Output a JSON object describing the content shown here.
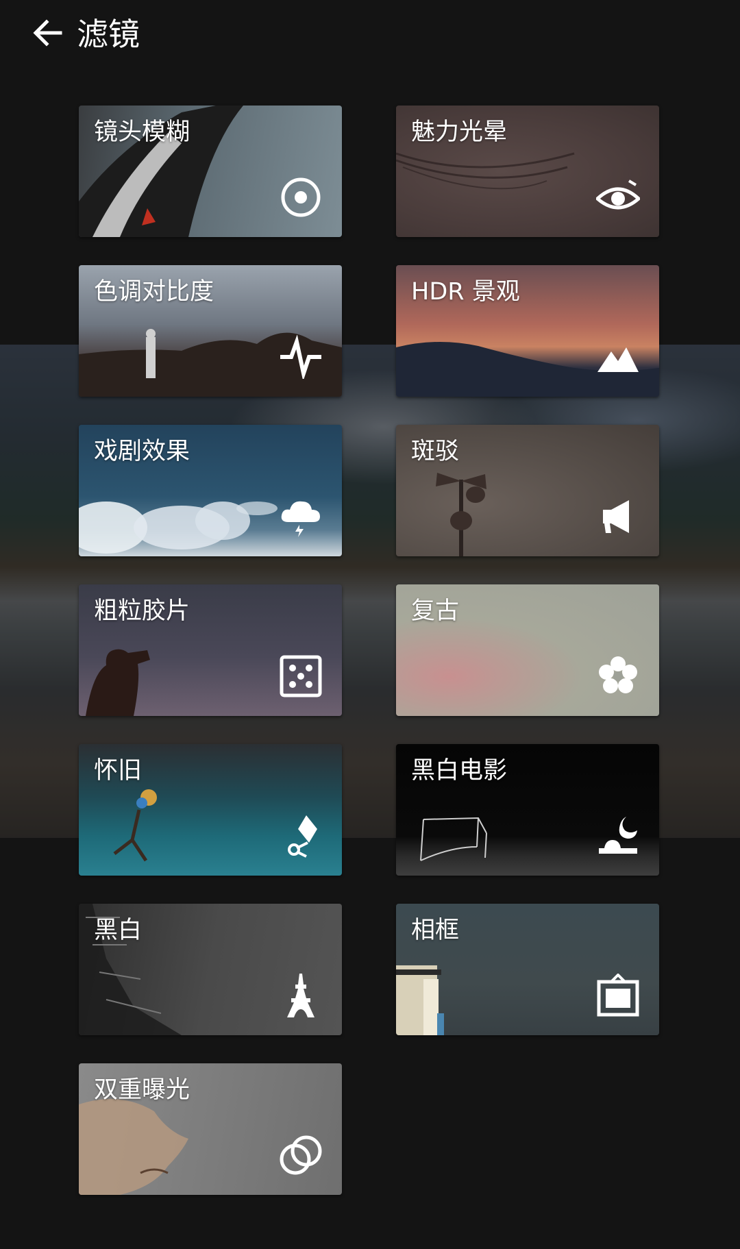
{
  "header": {
    "title": "滤镜",
    "back_icon": "arrow-left-icon"
  },
  "filters": [
    {
      "label": "镜头模糊",
      "icon": "target-circle-icon"
    },
    {
      "label": "魅力光晕",
      "icon": "eye-icon"
    },
    {
      "label": "色调对比度",
      "icon": "pulse-icon"
    },
    {
      "label": "HDR 景观",
      "icon": "mountains-icon"
    },
    {
      "label": "戏剧效果",
      "icon": "storm-cloud-icon"
    },
    {
      "label": "斑驳",
      "icon": "megaphone-icon"
    },
    {
      "label": "粗粒胶片",
      "icon": "dice-icon"
    },
    {
      "label": "复古",
      "icon": "flower-icon"
    },
    {
      "label": "怀旧",
      "icon": "kite-icon"
    },
    {
      "label": "黑白电影",
      "icon": "moon-night-icon"
    },
    {
      "label": "黑白",
      "icon": "eiffel-tower-icon"
    },
    {
      "label": "相框",
      "icon": "frame-icon"
    },
    {
      "label": "双重曝光",
      "icon": "double-circle-icon"
    }
  ],
  "colors": {
    "background": "#141414",
    "text": "#ffffff"
  }
}
